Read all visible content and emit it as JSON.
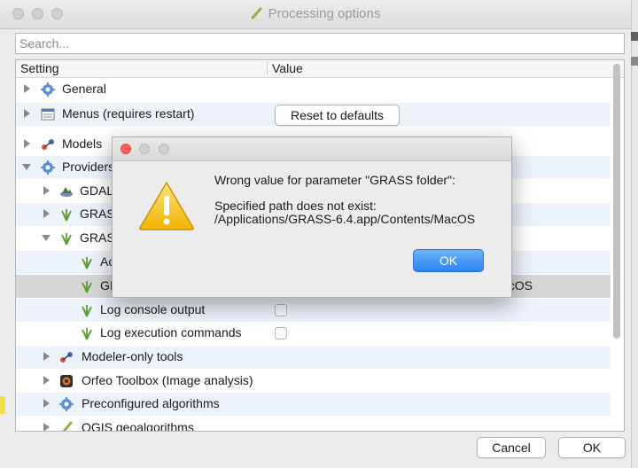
{
  "window": {
    "title": "Processing options",
    "search_placeholder": "Search..."
  },
  "tree": {
    "headers": {
      "setting": "Setting",
      "value": "Value"
    },
    "rows": [
      {
        "label": "General",
        "value": "",
        "icon": "gear-icon"
      },
      {
        "label": "Menus (requires restart)",
        "value": "",
        "icon": "menu-icon"
      },
      {
        "label": "Models",
        "value": "",
        "icon": "models-icon"
      },
      {
        "label": "Providers",
        "value": "",
        "icon": "gear-icon"
      },
      {
        "label": "GDAL",
        "value": "",
        "icon": "gdal-icon"
      },
      {
        "label": "GRASS",
        "value": "",
        "icon": "grass-icon"
      },
      {
        "label": "GRASS",
        "value": "",
        "icon": "grass-icon"
      },
      {
        "label": "Ac",
        "value": "",
        "icon": "grass-icon"
      },
      {
        "label": "GI",
        "value": "acOS",
        "icon": "grass-icon"
      },
      {
        "label": "Log console output",
        "value": "",
        "icon": "grass-icon"
      },
      {
        "label": "Log execution commands",
        "value": "",
        "icon": "grass-icon"
      },
      {
        "label": "Modeler-only tools",
        "value": "",
        "icon": "models-icon"
      },
      {
        "label": "Orfeo Toolbox (Image analysis)",
        "value": "",
        "icon": "orfeo-icon"
      },
      {
        "label": "Preconfigured algorithms",
        "value": "",
        "icon": "gear-icon"
      },
      {
        "label": "QGIS geoalgorithms",
        "value": "",
        "icon": "qgis-icon"
      }
    ],
    "reset_button": "Reset to defaults"
  },
  "footer": {
    "cancel": "Cancel",
    "ok": "OK"
  },
  "dialog": {
    "line1": "Wrong value for parameter \"GRASS folder\":",
    "line2": "Specified path does not exist:",
    "line3": "/Applications/GRASS-6.4.app/Contents/MacOS",
    "ok": "OK",
    "icon": "warning-icon"
  },
  "colors": {
    "accent": "#2a84f0",
    "close_red": "#fc5f57",
    "row_alt": "#edf3fb",
    "warning_yellow": "#f5c518"
  }
}
